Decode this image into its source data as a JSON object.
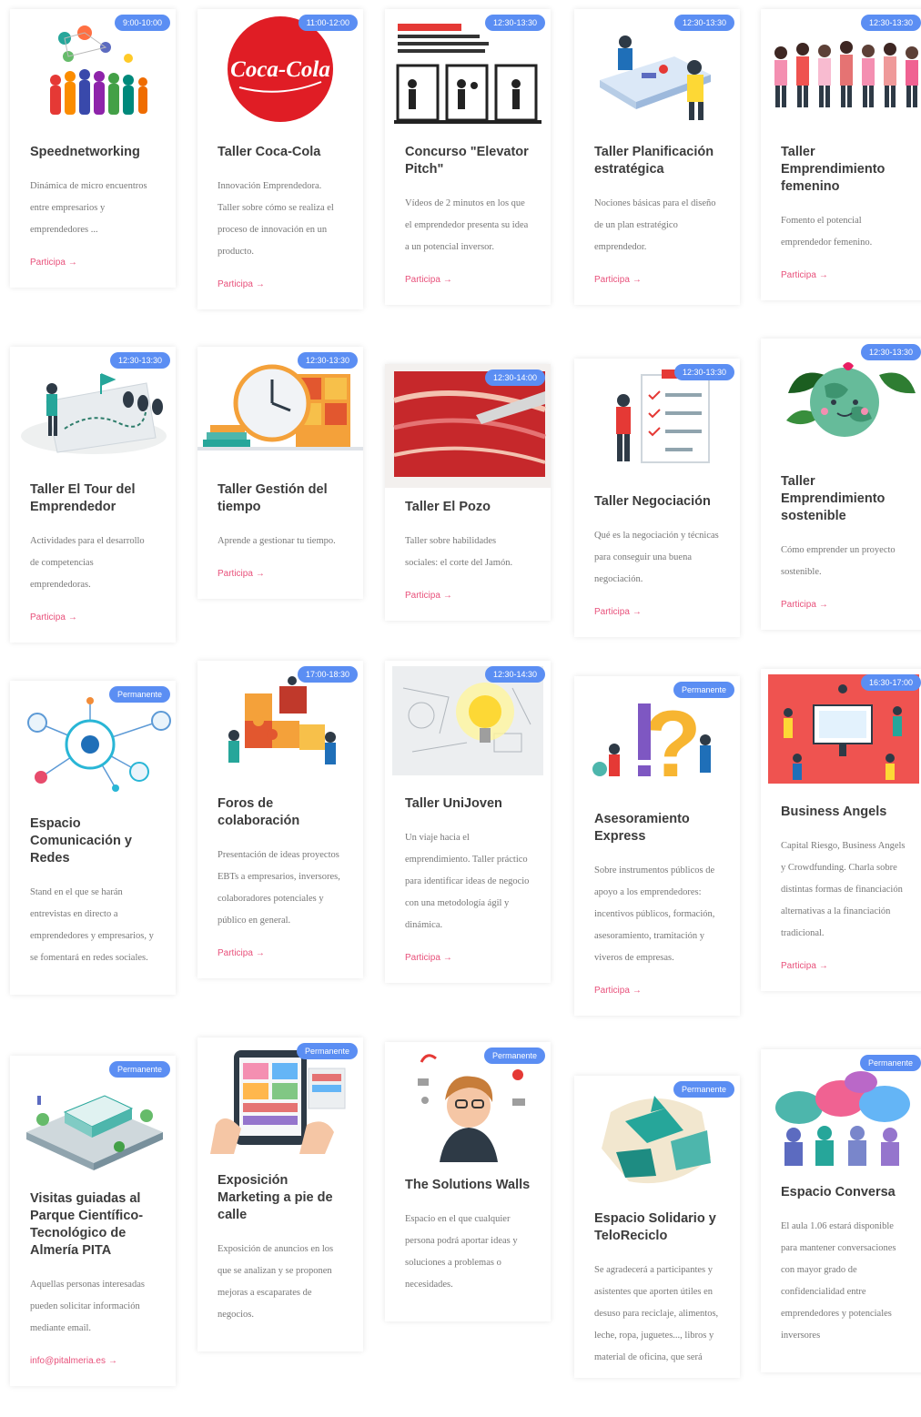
{
  "colors": {
    "badge": "#5b8ef3",
    "link": "#e8517b",
    "title": "#3c3c3c",
    "text": "#777777"
  },
  "cta_arrow": "→",
  "cards": [
    {
      "badge": "9:00-10:00",
      "title": "Speednetworking",
      "desc": "Dinámica de micro encuentros entre empresarios y emprendedores ...",
      "cta": "Participa",
      "icon": "people-network-icon"
    },
    {
      "badge": "11:00-12:00",
      "title": "Taller Coca-Cola",
      "desc": "Innovación Emprendedora. Taller sobre cómo se realiza el proceso de innovación en un producto.",
      "cta": "Participa",
      "icon": "coca-cola-logo",
      "logo_text": "Coca-Cola"
    },
    {
      "badge": "12:30-13:30",
      "title": "Concurso \"Elevator Pitch\"",
      "desc": "Vídeos de 2 minutos en los que el emprendedor presenta su idea a un potencial inversor.",
      "cta": "Participa",
      "icon": "elevator-pitch-icon"
    },
    {
      "badge": "12:30-13:30",
      "title": "Taller Planificación estratégica",
      "desc": "Nociones básicas para el diseño de un plan estratégico emprendedor.",
      "cta": "Participa",
      "icon": "meeting-icon"
    },
    {
      "badge": "12:30-13:30",
      "title": "Taller Emprendimiento femenino",
      "desc": "Fomento el potencial emprendedor femenino.",
      "cta": "Participa",
      "icon": "women-group-icon"
    },
    {
      "badge": "12:30-13:30",
      "title": "Taller El Tour del Emprendedor",
      "desc": "Actividades para el desarrollo de competencias emprendedoras.",
      "cta": "Participa",
      "icon": "tour-map-icon"
    },
    {
      "badge": "12:30-13:30",
      "title": "Taller Gestión del tiempo",
      "desc": "Aprende a gestionar tu tiempo.",
      "cta": "Participa",
      "icon": "clock-icon"
    },
    {
      "badge": "12:30-14:00",
      "title": "Taller El Pozo",
      "desc": "Taller sobre habilidades sociales: el corte del Jamón.",
      "cta": "Participa",
      "icon": "ham-icon"
    },
    {
      "badge": "12:30-13:30",
      "title": "Taller Negociación",
      "desc": "Qué es la negociación y técnicas para conseguir una buena negociación.",
      "cta": "Participa",
      "icon": "checklist-icon"
    },
    {
      "badge": "12:30-13:30",
      "title": "Taller Emprendimiento sostenible",
      "desc": "Cómo emprender un proyecto sostenible.",
      "cta": "Participa",
      "icon": "earth-icon"
    },
    {
      "badge": "Permanente",
      "title": "Espacio Comunicación y Redes",
      "desc": "Stand en el que se harán entrevistas en directo a emprendedores y empresarios, y se fomentará en redes sociales.",
      "cta": "",
      "icon": "network-hub-icon"
    },
    {
      "badge": "17:00-18:30",
      "title": "Foros de colaboración",
      "desc": "Presentación de ideas proyectos EBTs a empresarios, inversores, colaboradores potenciales y público en general.",
      "cta": "Participa",
      "icon": "puzzle-icon"
    },
    {
      "badge": "12:30-14:30",
      "title": "Taller UniJoven",
      "desc": "Un viaje hacia el emprendimiento. Taller práctico para identificar ideas de negocio con una metodología ágil y dinámica.",
      "cta": "Participa",
      "icon": "lightbulb-icon"
    },
    {
      "badge": "Permanente",
      "title": "Asesoramiento Express",
      "desc": "Sobre instrumentos públicos de apoyo a los emprendedores: incentivos públicos, formación, asesoramiento, tramitación y viveros de empresas.",
      "cta": "Participa",
      "icon": "question-icon"
    },
    {
      "badge": "16:30-17:00",
      "title": "Business Angels",
      "desc": "Capital Riesgo, Business Angels y Crowdfunding. Charla sobre distintas formas de financiación alternativas a la financiación tradicional.",
      "cta": "Participa",
      "icon": "presentation-icon"
    },
    {
      "badge": "Permanente",
      "title": "Visitas guiadas al Parque Científico-Tecnológico de Almería PITA",
      "desc": "Aquellas personas interesadas pueden solicitar información mediante email.",
      "cta": "info@pitalmeria.es",
      "icon": "science-park-icon"
    },
    {
      "badge": "Permanente",
      "title": "Exposición Marketing a pie de calle",
      "desc": "Exposición de anuncios en los que se analizan y se proponen mejoras a escaparates de negocios.",
      "cta": "",
      "icon": "tablet-icon"
    },
    {
      "badge": "Permanente",
      "title": "The Solutions Walls",
      "desc": "Espacio en el que cualquier persona podrá aportar ideas y soluciones a problemas o necesidades.",
      "cta": "",
      "icon": "thinking-person-icon"
    },
    {
      "badge": "Permanente",
      "title": "Espacio Solidario y TeloReciclo",
      "desc": "Se agradecerá a participantes y asistentes que aporten útiles en desuso para reciclaje, alimentos, leche, ropa, juguetes..., libros y material de oficina, que será",
      "cta": "",
      "icon": "recycle-icon"
    },
    {
      "badge": "Permanente",
      "title": "Espacio Conversa",
      "desc": "El aula 1.06 estará disponible para mantener conversaciones con mayor grado de confidencialidad entre emprendedores y potenciales inversores",
      "cta": "",
      "icon": "speech-bubbles-icon"
    }
  ]
}
